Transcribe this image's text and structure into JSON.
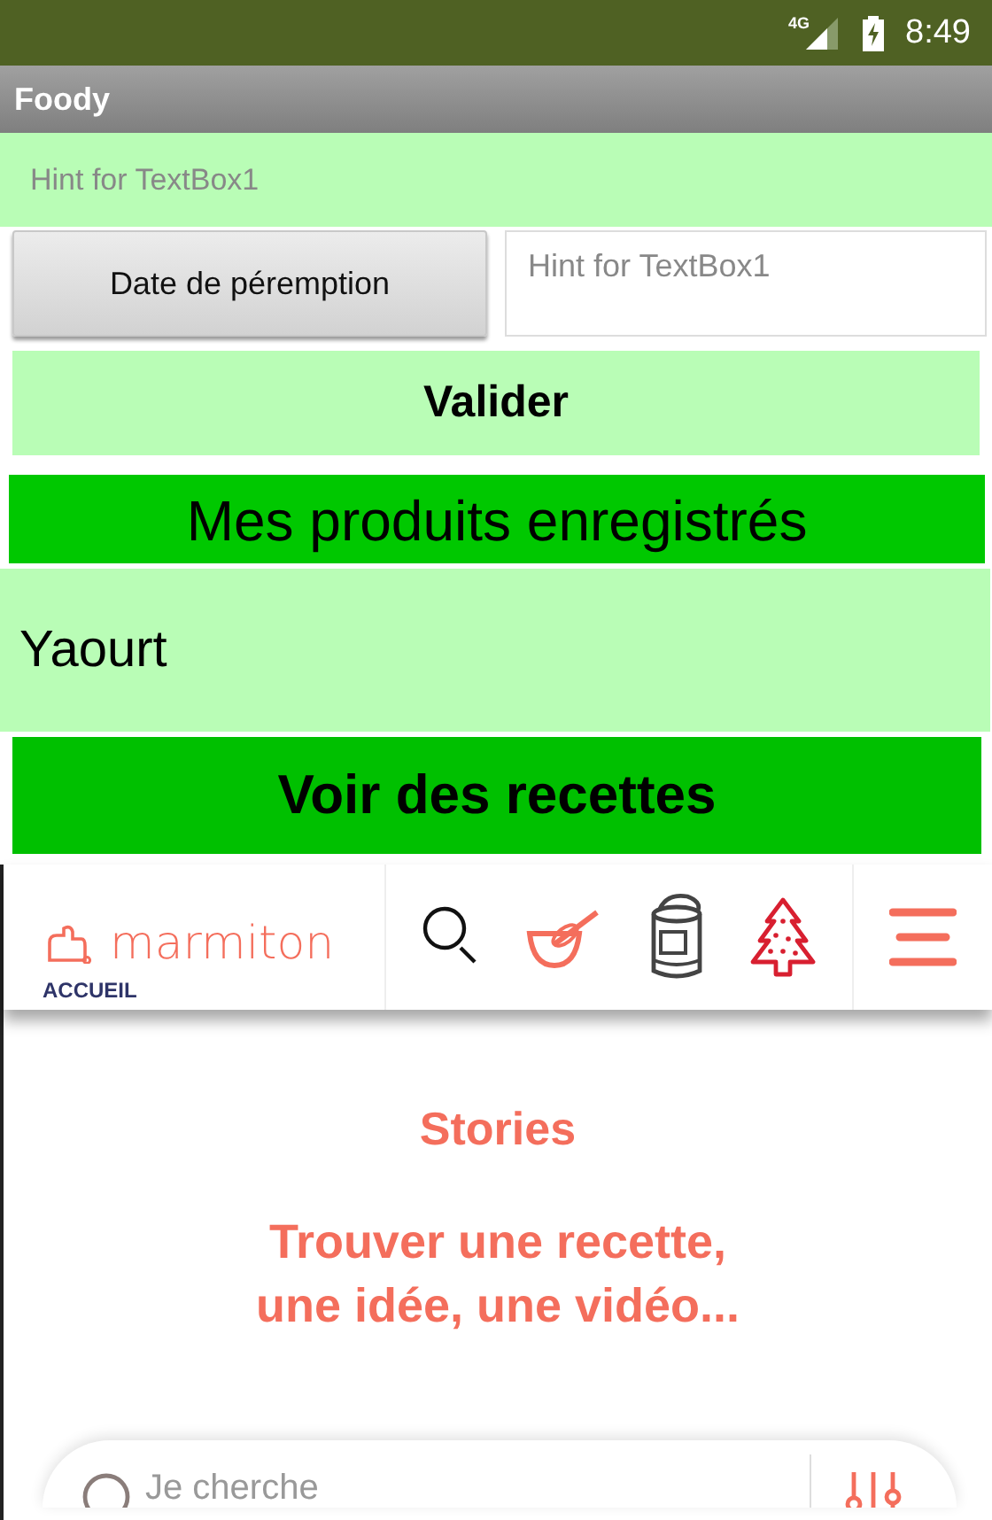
{
  "status_bar": {
    "network": "4G",
    "time": "8:49"
  },
  "window": {
    "title": "Foody"
  },
  "textbox_top": {
    "placeholder": "Hint for TextBox1"
  },
  "date_button": {
    "label": "Date de péremption"
  },
  "date_textbox": {
    "placeholder": "Hint for TextBox1"
  },
  "validate_button": {
    "label": "Valider"
  },
  "saved_header": {
    "text": "Mes produits enregistrés"
  },
  "saved_list": [
    "Yaourt"
  ],
  "recipes_button": {
    "label": "Voir des recettes"
  },
  "web": {
    "logo": "marmiton",
    "home_label": "ACCUEIL",
    "stories": "Stories",
    "headline_lines": [
      "Trouver une recette,",
      "une idée, une vidéo..."
    ],
    "search": {
      "placeholder": "Je cherche"
    }
  }
}
